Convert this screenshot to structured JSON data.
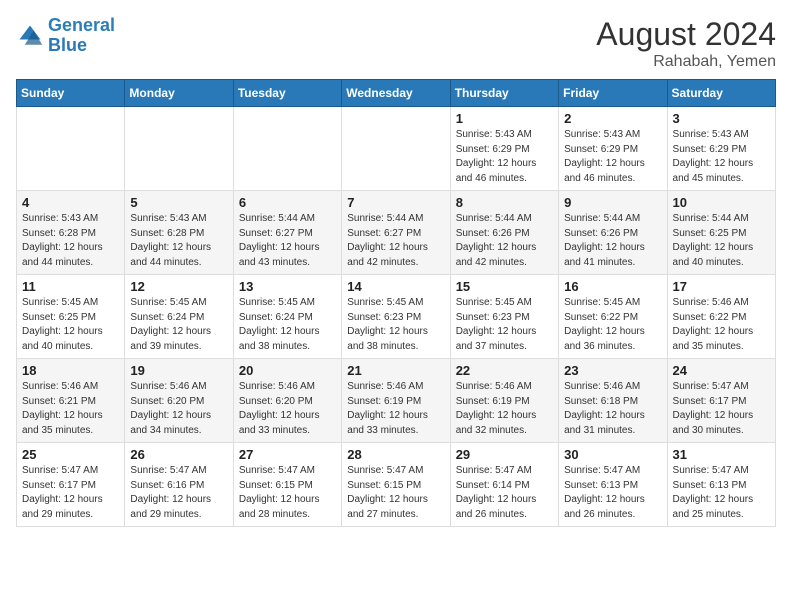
{
  "header": {
    "logo_line1": "General",
    "logo_line2": "Blue",
    "month_year": "August 2024",
    "location": "Rahabah, Yemen"
  },
  "weekdays": [
    "Sunday",
    "Monday",
    "Tuesday",
    "Wednesday",
    "Thursday",
    "Friday",
    "Saturday"
  ],
  "weeks": [
    [
      {
        "day": "",
        "info": ""
      },
      {
        "day": "",
        "info": ""
      },
      {
        "day": "",
        "info": ""
      },
      {
        "day": "",
        "info": ""
      },
      {
        "day": "1",
        "info": "Sunrise: 5:43 AM\nSunset: 6:29 PM\nDaylight: 12 hours\nand 46 minutes."
      },
      {
        "day": "2",
        "info": "Sunrise: 5:43 AM\nSunset: 6:29 PM\nDaylight: 12 hours\nand 46 minutes."
      },
      {
        "day": "3",
        "info": "Sunrise: 5:43 AM\nSunset: 6:29 PM\nDaylight: 12 hours\nand 45 minutes."
      }
    ],
    [
      {
        "day": "4",
        "info": "Sunrise: 5:43 AM\nSunset: 6:28 PM\nDaylight: 12 hours\nand 44 minutes."
      },
      {
        "day": "5",
        "info": "Sunrise: 5:43 AM\nSunset: 6:28 PM\nDaylight: 12 hours\nand 44 minutes."
      },
      {
        "day": "6",
        "info": "Sunrise: 5:44 AM\nSunset: 6:27 PM\nDaylight: 12 hours\nand 43 minutes."
      },
      {
        "day": "7",
        "info": "Sunrise: 5:44 AM\nSunset: 6:27 PM\nDaylight: 12 hours\nand 42 minutes."
      },
      {
        "day": "8",
        "info": "Sunrise: 5:44 AM\nSunset: 6:26 PM\nDaylight: 12 hours\nand 42 minutes."
      },
      {
        "day": "9",
        "info": "Sunrise: 5:44 AM\nSunset: 6:26 PM\nDaylight: 12 hours\nand 41 minutes."
      },
      {
        "day": "10",
        "info": "Sunrise: 5:44 AM\nSunset: 6:25 PM\nDaylight: 12 hours\nand 40 minutes."
      }
    ],
    [
      {
        "day": "11",
        "info": "Sunrise: 5:45 AM\nSunset: 6:25 PM\nDaylight: 12 hours\nand 40 minutes."
      },
      {
        "day": "12",
        "info": "Sunrise: 5:45 AM\nSunset: 6:24 PM\nDaylight: 12 hours\nand 39 minutes."
      },
      {
        "day": "13",
        "info": "Sunrise: 5:45 AM\nSunset: 6:24 PM\nDaylight: 12 hours\nand 38 minutes."
      },
      {
        "day": "14",
        "info": "Sunrise: 5:45 AM\nSunset: 6:23 PM\nDaylight: 12 hours\nand 38 minutes."
      },
      {
        "day": "15",
        "info": "Sunrise: 5:45 AM\nSunset: 6:23 PM\nDaylight: 12 hours\nand 37 minutes."
      },
      {
        "day": "16",
        "info": "Sunrise: 5:45 AM\nSunset: 6:22 PM\nDaylight: 12 hours\nand 36 minutes."
      },
      {
        "day": "17",
        "info": "Sunrise: 5:46 AM\nSunset: 6:22 PM\nDaylight: 12 hours\nand 35 minutes."
      }
    ],
    [
      {
        "day": "18",
        "info": "Sunrise: 5:46 AM\nSunset: 6:21 PM\nDaylight: 12 hours\nand 35 minutes."
      },
      {
        "day": "19",
        "info": "Sunrise: 5:46 AM\nSunset: 6:20 PM\nDaylight: 12 hours\nand 34 minutes."
      },
      {
        "day": "20",
        "info": "Sunrise: 5:46 AM\nSunset: 6:20 PM\nDaylight: 12 hours\nand 33 minutes."
      },
      {
        "day": "21",
        "info": "Sunrise: 5:46 AM\nSunset: 6:19 PM\nDaylight: 12 hours\nand 33 minutes."
      },
      {
        "day": "22",
        "info": "Sunrise: 5:46 AM\nSunset: 6:19 PM\nDaylight: 12 hours\nand 32 minutes."
      },
      {
        "day": "23",
        "info": "Sunrise: 5:46 AM\nSunset: 6:18 PM\nDaylight: 12 hours\nand 31 minutes."
      },
      {
        "day": "24",
        "info": "Sunrise: 5:47 AM\nSunset: 6:17 PM\nDaylight: 12 hours\nand 30 minutes."
      }
    ],
    [
      {
        "day": "25",
        "info": "Sunrise: 5:47 AM\nSunset: 6:17 PM\nDaylight: 12 hours\nand 29 minutes."
      },
      {
        "day": "26",
        "info": "Sunrise: 5:47 AM\nSunset: 6:16 PM\nDaylight: 12 hours\nand 29 minutes."
      },
      {
        "day": "27",
        "info": "Sunrise: 5:47 AM\nSunset: 6:15 PM\nDaylight: 12 hours\nand 28 minutes."
      },
      {
        "day": "28",
        "info": "Sunrise: 5:47 AM\nSunset: 6:15 PM\nDaylight: 12 hours\nand 27 minutes."
      },
      {
        "day": "29",
        "info": "Sunrise: 5:47 AM\nSunset: 6:14 PM\nDaylight: 12 hours\nand 26 minutes."
      },
      {
        "day": "30",
        "info": "Sunrise: 5:47 AM\nSunset: 6:13 PM\nDaylight: 12 hours\nand 26 minutes."
      },
      {
        "day": "31",
        "info": "Sunrise: 5:47 AM\nSunset: 6:13 PM\nDaylight: 12 hours\nand 25 minutes."
      }
    ]
  ]
}
